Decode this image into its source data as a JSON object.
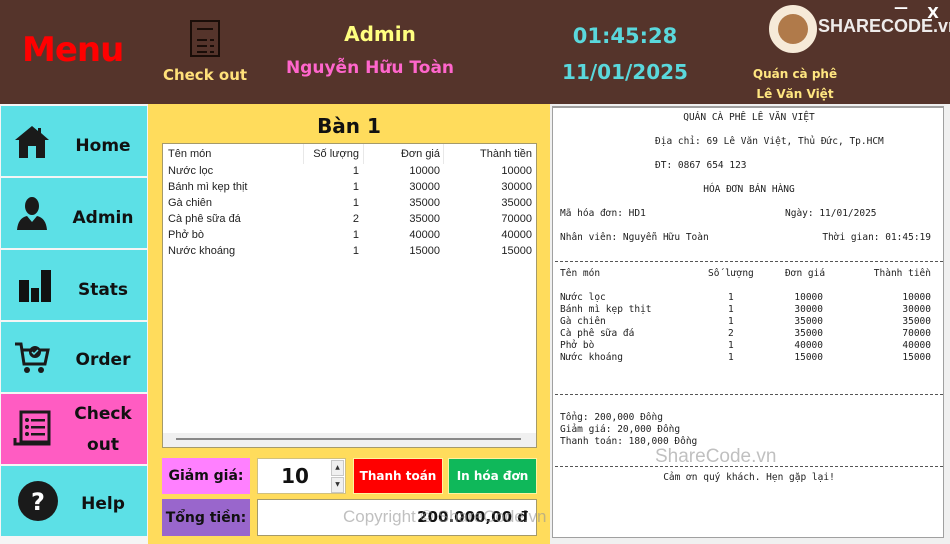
{
  "header": {
    "menu_title": "Menu",
    "checkout_label": "Check out",
    "role": "Admin",
    "user_name": "Nguyễn Hữu Toàn",
    "time": "01:45:28",
    "date": "11/01/2025",
    "shop_line1": "Quán cà phê",
    "shop_line2": "Lê Văn Việt",
    "minimize": "—",
    "close": "X"
  },
  "sidebar": {
    "items": [
      {
        "label": "Home",
        "icon": "home-icon",
        "active": false
      },
      {
        "label": "Admin",
        "icon": "user-icon",
        "active": false
      },
      {
        "label": "Stats",
        "icon": "bar-chart-icon",
        "active": false
      },
      {
        "label": "Order",
        "icon": "cart-icon",
        "active": false
      },
      {
        "label": "Check",
        "label2": "out",
        "icon": "receipt-icon",
        "active": true
      },
      {
        "label": "Help",
        "icon": "help-icon",
        "active": false
      }
    ]
  },
  "order": {
    "table_title": "Bàn 1",
    "columns": [
      "Tên món",
      "Số lượng",
      "Đơn giá",
      "Thành tiền"
    ],
    "rows": [
      {
        "name": "Nước lọc",
        "qty": "1",
        "price": "10000",
        "total": "10000"
      },
      {
        "name": "Bánh mì kẹp thịt",
        "qty": "1",
        "price": "30000",
        "total": "30000"
      },
      {
        "name": "Gà chiên",
        "qty": "1",
        "price": "35000",
        "total": "35000"
      },
      {
        "name": "Cà phê sữa đá",
        "qty": "2",
        "price": "35000",
        "total": "70000"
      },
      {
        "name": "Phở bò",
        "qty": "1",
        "price": "40000",
        "total": "40000"
      },
      {
        "name": "Nước khoáng",
        "qty": "1",
        "price": "15000",
        "total": "15000"
      }
    ],
    "discount_label": "Giảm giá:",
    "discount_value": "10",
    "pay_button": "Thanh toán",
    "print_button": "In hóa đơn",
    "total_label": "Tổng tiền:",
    "total_value": "200.000,00 đ"
  },
  "receipt": {
    "shop_name": "QUÁN CÀ PHÊ LÊ VĂN VIỆT",
    "address": "Địa chỉ: 69 Lê Văn Việt, Thủ Đức, Tp.HCM",
    "phone": "ĐT: 0867 654 123",
    "title": "HÓA ĐƠN BÁN HÀNG",
    "invoice_id": "Mã hóa đơn: HD1",
    "date": "Ngày: 11/01/2025",
    "staff": "Nhân viên: Nguyễn Hữu Toàn",
    "time": "Thời gian: 01:45:19",
    "columns": [
      "Tên món",
      "Số lượng",
      "Đơn giá",
      "Thành tiền"
    ],
    "rows": [
      {
        "name": "Nước lọc",
        "qty": "1",
        "price": "10000",
        "total": "10000"
      },
      {
        "name": "Bánh mì kẹp thịt",
        "qty": "1",
        "price": "30000",
        "total": "30000"
      },
      {
        "name": "Gà chiên",
        "qty": "1",
        "price": "35000",
        "total": "35000"
      },
      {
        "name": "Cà phê sữa đá",
        "qty": "2",
        "price": "35000",
        "total": "70000"
      },
      {
        "name": "Phở bò",
        "qty": "1",
        "price": "40000",
        "total": "40000"
      },
      {
        "name": "Nước khoáng",
        "qty": "1",
        "price": "15000",
        "total": "15000"
      }
    ],
    "sum": "Tổng: 200,000 Đồng",
    "discount": "Giảm giá: 20,000 Đồng",
    "payment": "Thanh toán: 180,000 Đồng",
    "thanks": "Cảm ơn quý khách. Hẹn gặp lại!"
  },
  "watermarks": {
    "logo": "SHARECODE.vn",
    "center": "ShareCode.vn",
    "copyright": "Copyright © ShareCode.vn"
  }
}
